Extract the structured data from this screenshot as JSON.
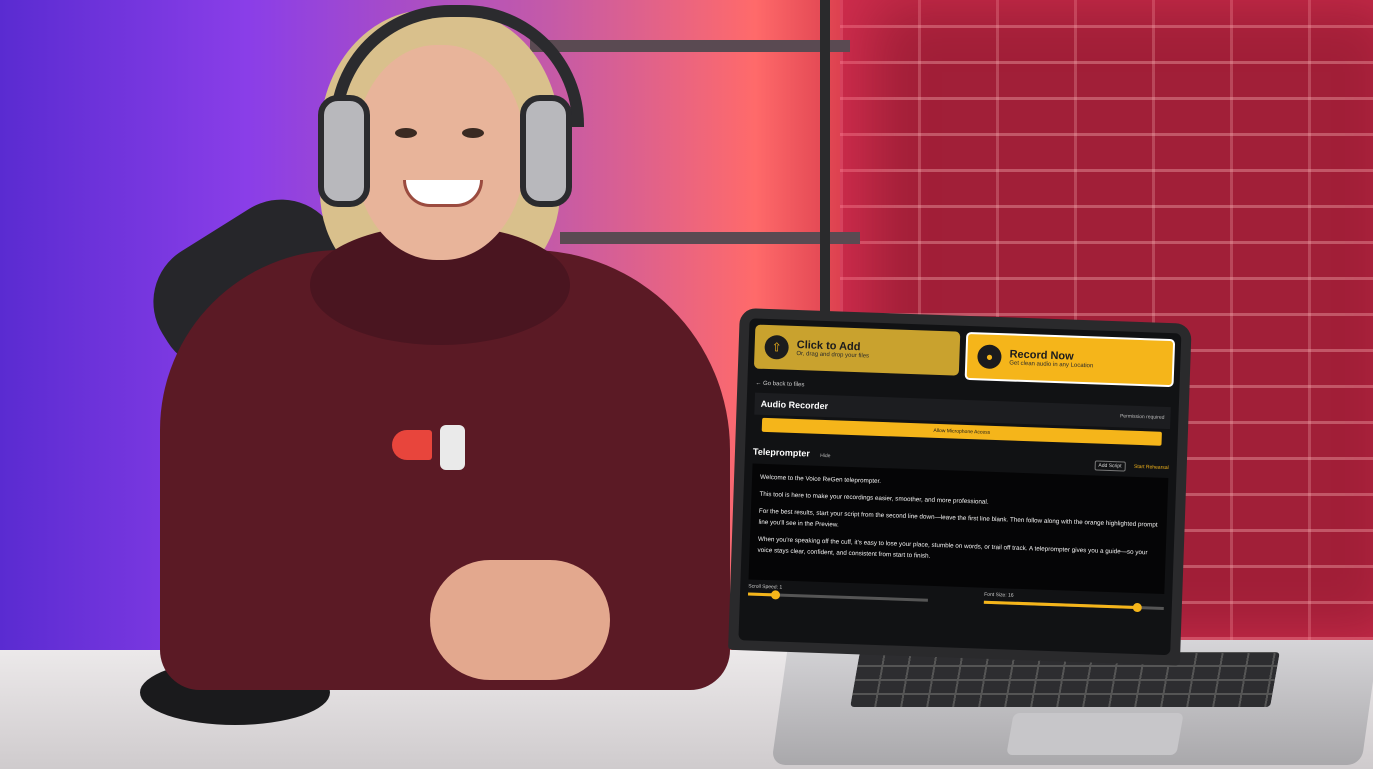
{
  "app": {
    "add_card": {
      "title": "Click to Add",
      "subtitle": "Or, drag and drop your files"
    },
    "record_card": {
      "title": "Record Now",
      "subtitle": "Get clean audio in any Location"
    },
    "back_link": "← Go back to files",
    "recorder": {
      "title": "Audio Recorder",
      "requirement": "Permission required",
      "allow_button": "Allow Microphone Access"
    },
    "teleprompter": {
      "title": "Teleprompter",
      "hide_label": "Hide",
      "add_script": "Add Script",
      "start_label": "Start Rehearsal",
      "paragraphs": [
        "Welcome to the Voice ReGen teleprompter.",
        "This tool is here to make your recordings easier, smoother, and more professional.",
        "For the best results, start your script from the second line down—leave the first line blank. Then follow along with the orange highlighted prompt line you'll see in the Preview.",
        "When you're speaking off the cuff, it's easy to lose your place, stumble on words, or trail off track. A teleprompter gives you a guide—so your voice stays clear, confident, and consistent from start to finish."
      ]
    },
    "sliders": {
      "scroll_speed_label": "Scroll Speed: 1",
      "font_size_label": "Font Size: 16",
      "scroll_speed_fraction": 0.15,
      "font_size_fraction": 0.85
    }
  },
  "colors": {
    "accent": "#f5b51a",
    "hoodie": "#5b1a25",
    "brick": "#a11f38"
  }
}
